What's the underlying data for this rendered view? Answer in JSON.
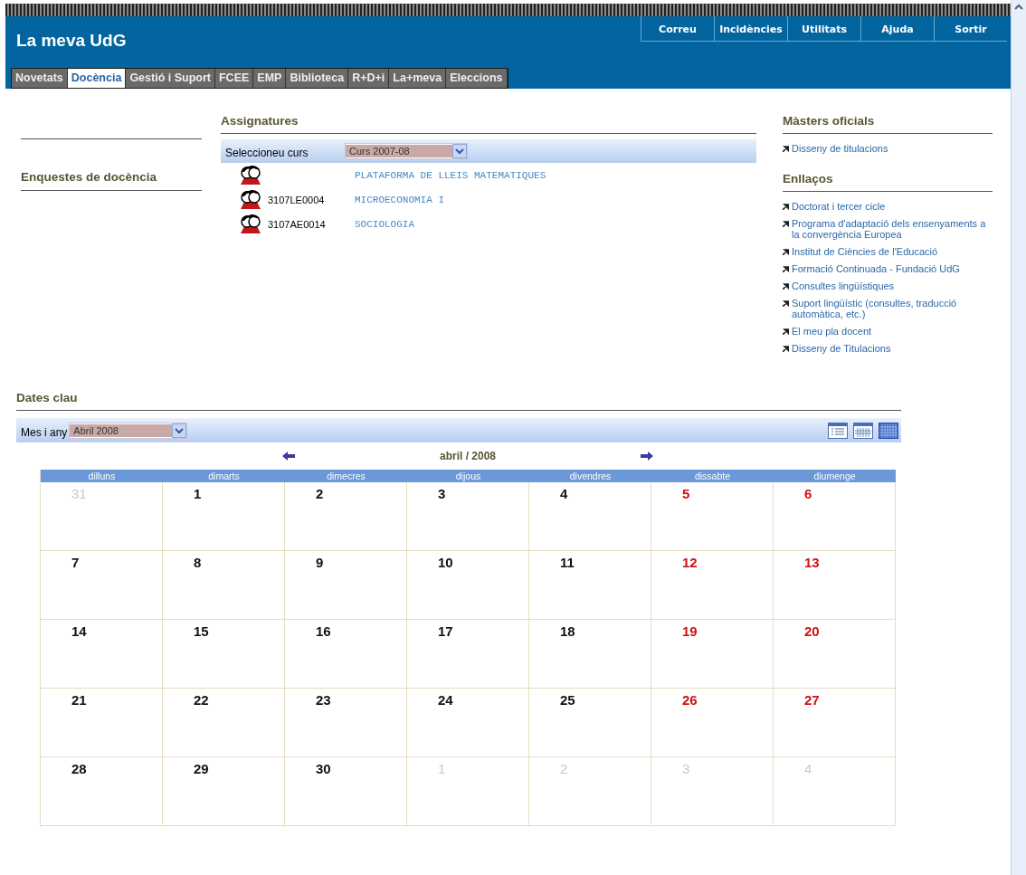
{
  "header": {
    "title": "La meva UdG",
    "top_links": [
      "Correu",
      "Incidències",
      "Utilitats",
      "Ajuda",
      "Sortir"
    ]
  },
  "tabs": [
    {
      "label": "Novetats",
      "selected": false
    },
    {
      "label": "Docència",
      "selected": true
    },
    {
      "label": "Gestió i Suport",
      "selected": false
    },
    {
      "label": "FCEE",
      "selected": false
    },
    {
      "label": "EMP",
      "selected": false
    },
    {
      "label": "Biblioteca",
      "selected": false
    },
    {
      "label": "R+D+i",
      "selected": false
    },
    {
      "label": "La+meva",
      "selected": false
    },
    {
      "label": "Eleccions",
      "selected": false
    }
  ],
  "left": {
    "section_title": "Enquestes de docència"
  },
  "assignatures": {
    "title": "Assignatures",
    "select_label": "Seleccioneu curs",
    "select_value": "Curs 2007-08",
    "courses": [
      {
        "name": "PLATAFORMA DE LLEIS MATEMATIQUES"
      },
      {
        "code": "3107LE0004",
        "name": "MICROECONOMIA I"
      },
      {
        "code": "3107AE0014",
        "name": "SOCIOLOGIA"
      }
    ]
  },
  "masters": {
    "title": "Màsters oficials",
    "links": [
      "Disseny de titulacions"
    ]
  },
  "enllacos": {
    "title": "Enllaços",
    "links": [
      "Doctorat i tercer cicle",
      "Programa d'adaptació dels ensenyaments a la convergència Europea",
      "Institut de Ciències de l'Educació",
      "Formació Continuada - Fundació UdG",
      "Consultes lingüístiques",
      "Suport lingüístic (consultes, traducció automàtica, etc.)",
      "El meu pla docent",
      "Disseny de Titulacions"
    ]
  },
  "dates_clau": {
    "title": "Dates clau",
    "select_label": "Mes i any",
    "select_value": "Abril 2008",
    "month_label": "abril / 2008",
    "weekdays": [
      "dilluns",
      "dimarts",
      "dimecres",
      "dijous",
      "divendres",
      "dissabte",
      "diumenge"
    ],
    "weeks": [
      [
        {
          "day": "31",
          "kind": "other"
        },
        {
          "day": "1",
          "kind": "weekday"
        },
        {
          "day": "2",
          "kind": "weekday"
        },
        {
          "day": "3",
          "kind": "weekday"
        },
        {
          "day": "4",
          "kind": "weekday"
        },
        {
          "day": "5",
          "kind": "weekend"
        },
        {
          "day": "6",
          "kind": "weekend"
        }
      ],
      [
        {
          "day": "7",
          "kind": "weekday"
        },
        {
          "day": "8",
          "kind": "weekday"
        },
        {
          "day": "9",
          "kind": "weekday"
        },
        {
          "day": "10",
          "kind": "weekday"
        },
        {
          "day": "11",
          "kind": "weekday"
        },
        {
          "day": "12",
          "kind": "weekend"
        },
        {
          "day": "13",
          "kind": "weekend"
        }
      ],
      [
        {
          "day": "14",
          "kind": "weekday"
        },
        {
          "day": "15",
          "kind": "weekday"
        },
        {
          "day": "16",
          "kind": "weekday"
        },
        {
          "day": "17",
          "kind": "weekday"
        },
        {
          "day": "18",
          "kind": "weekday"
        },
        {
          "day": "19",
          "kind": "weekend"
        },
        {
          "day": "20",
          "kind": "weekend"
        }
      ],
      [
        {
          "day": "21",
          "kind": "weekday"
        },
        {
          "day": "22",
          "kind": "weekday"
        },
        {
          "day": "23",
          "kind": "weekday"
        },
        {
          "day": "24",
          "kind": "weekday"
        },
        {
          "day": "25",
          "kind": "weekday"
        },
        {
          "day": "26",
          "kind": "weekend"
        },
        {
          "day": "27",
          "kind": "weekend"
        }
      ],
      [
        {
          "day": "28",
          "kind": "weekday"
        },
        {
          "day": "29",
          "kind": "weekday"
        },
        {
          "day": "30",
          "kind": "weekday"
        },
        {
          "day": "1",
          "kind": "other"
        },
        {
          "day": "2",
          "kind": "other"
        },
        {
          "day": "3",
          "kind": "other"
        },
        {
          "day": "4",
          "kind": "other"
        }
      ]
    ]
  }
}
